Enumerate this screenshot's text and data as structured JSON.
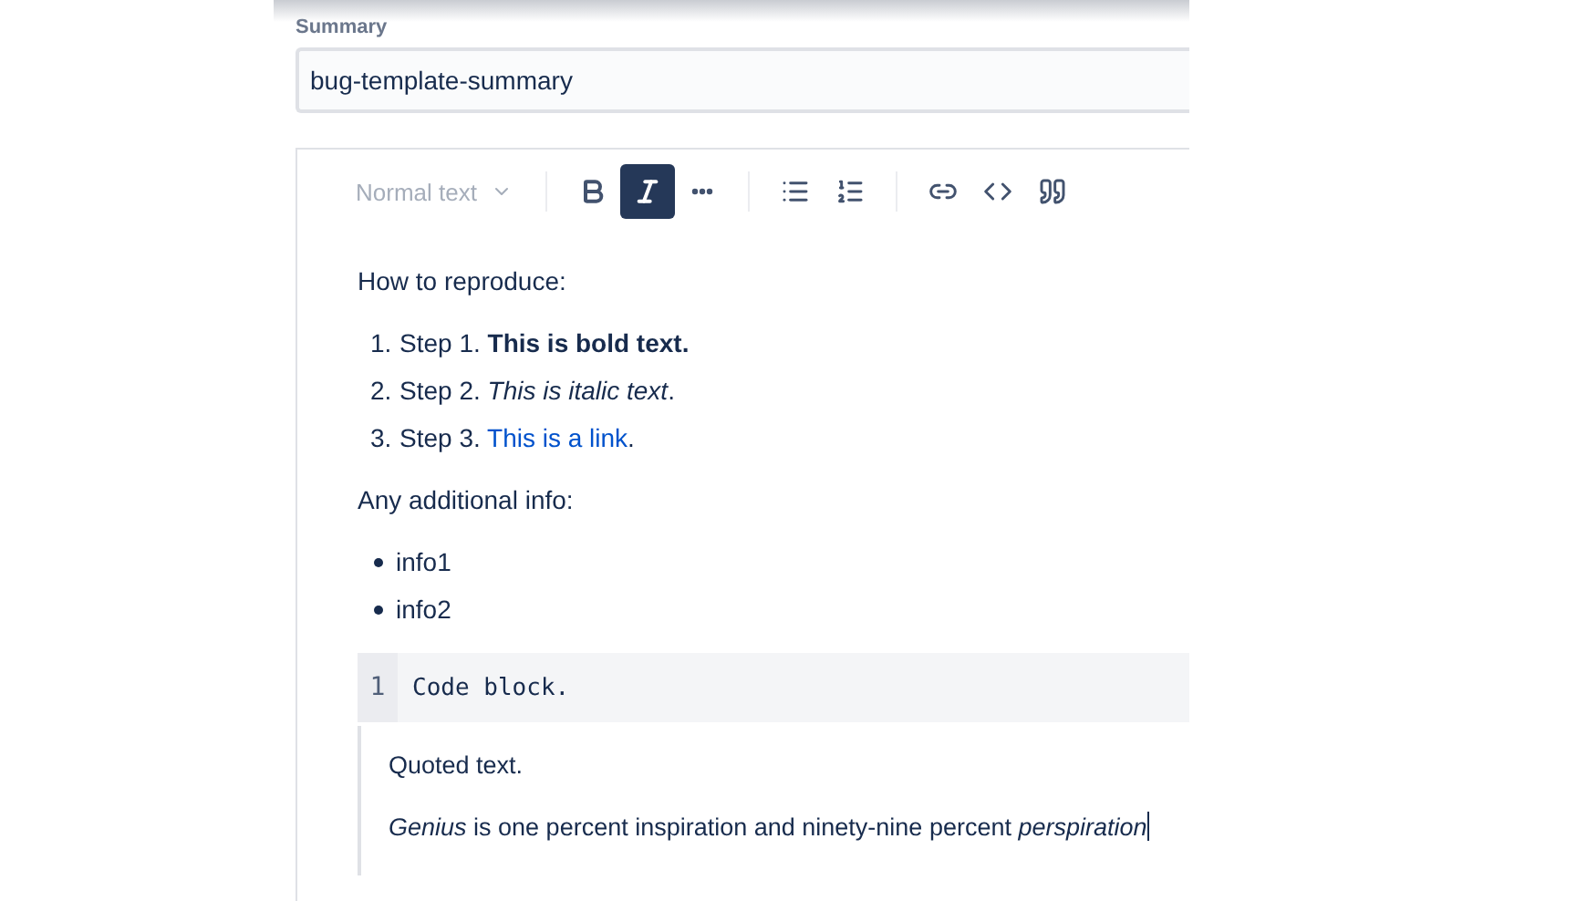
{
  "summary": {
    "label": "Summary",
    "value": "bug-template-summary"
  },
  "toolbar": {
    "text_style": {
      "label": "Normal text",
      "disabled": true
    },
    "groups": [
      [
        {
          "kind": "bold",
          "selected": false
        },
        {
          "kind": "italic",
          "selected": true
        },
        {
          "kind": "more",
          "selected": false
        }
      ],
      [
        {
          "kind": "bullet-list",
          "selected": false
        },
        {
          "kind": "numbered-list",
          "selected": false
        }
      ],
      [
        {
          "kind": "link",
          "selected": false
        },
        {
          "kind": "code",
          "selected": false
        },
        {
          "kind": "quote",
          "selected": false
        }
      ]
    ]
  },
  "content": [
    {
      "kind": "paragraph",
      "text": "How to reproduce:"
    },
    {
      "kind": "ordered",
      "items": [
        {
          "marker": "1.",
          "text": "Step 1. **This is bold text.**"
        },
        {
          "marker": "2.",
          "text": "Step 2. *This is italic text*."
        },
        {
          "marker": "3.",
          "text": "Step 3.",
          "link": "This is a link",
          "tail": "."
        }
      ]
    },
    {
      "kind": "paragraph",
      "text": "Any additional info:"
    },
    {
      "kind": "bullets",
      "items": [
        {
          "text": "info1"
        },
        {
          "text": "info2"
        }
      ]
    },
    {
      "kind": "code",
      "lines": [
        {
          "number": "1",
          "text": "Code block."
        }
      ]
    },
    {
      "kind": "quote",
      "paragraphs": [
        {
          "text": "Quoted text.",
          "cursor": false
        },
        {
          "text": "*Genius* is one percent inspiration and ninety-nine percent *perspiration*",
          "cursor": true
        }
      ]
    }
  ]
}
